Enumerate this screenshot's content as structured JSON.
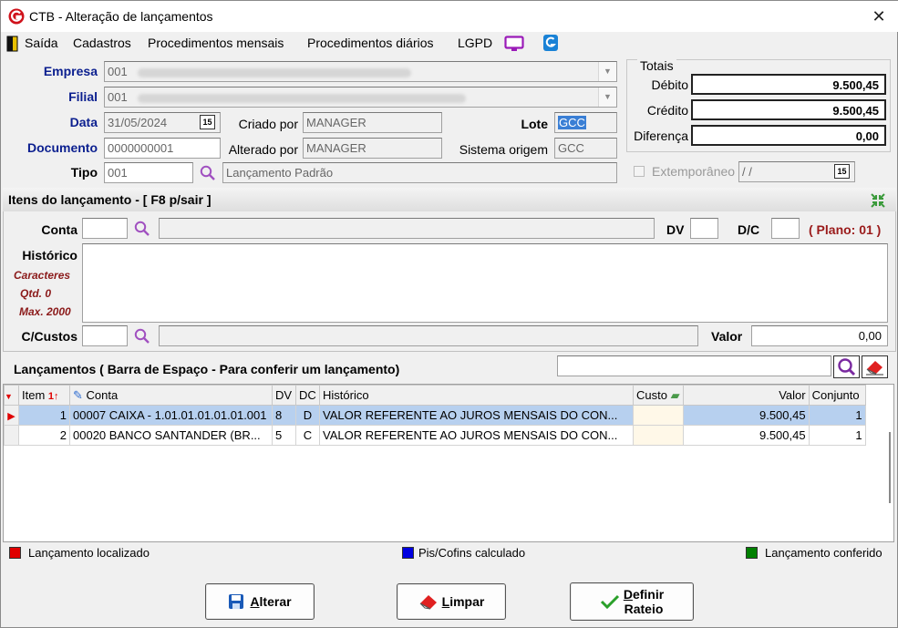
{
  "window": {
    "title": "CTB - Alteração de lançamentos",
    "close": "✕"
  },
  "menu": {
    "items": [
      "Saída",
      "Cadastros",
      "Procedimentos mensais",
      "Procedimentos diários",
      "LGPD"
    ]
  },
  "header": {
    "empresa_label": "Empresa",
    "empresa_value": "001",
    "filial_label": "Filial",
    "filial_value": "001",
    "data_label": "Data",
    "data_value": "31/05/2024",
    "documento_label": "Documento",
    "documento_value": "0000000001",
    "tipo_label": "Tipo",
    "tipo_value": "001",
    "tipo_desc": "Lançamento Padrão",
    "criado_label": "Criado por",
    "criado_value": "MANAGER",
    "alterado_label": "Alterado por",
    "alterado_value": "MANAGER",
    "lote_label": "Lote",
    "lote_value": "GCC",
    "sistema_label": "Sistema origem",
    "sistema_value": "GCC",
    "calendar_text": "15"
  },
  "totais": {
    "legend": "Totais",
    "debito_label": "Débito",
    "debito_value": "9.500,45",
    "credito_label": "Crédito",
    "credito_value": "9.500,45",
    "diferenca_label": "Diferença",
    "diferenca_value": "0,00",
    "extemporaneo_label": "Extemporâneo",
    "extemporaneo_value": "/ /"
  },
  "itens": {
    "title": "Itens do lançamento - [ F8 p/sair ]",
    "conta_label": "Conta",
    "dv_label": "DV",
    "dc_label": "D/C",
    "plano": "( Plano: 01 )",
    "historico_label": "Histórico",
    "caracteres_label": "Caracteres",
    "qtd_label": "Qtd. 0",
    "max_label": "Max. 2000",
    "ccustos_label": "C/Custos",
    "valor_label": "Valor",
    "valor_value": "0,00"
  },
  "lancamentos": {
    "title": "Lançamentos ( Barra de Espaço - Para conferir um lançamento)",
    "columns": [
      "Item",
      "Conta",
      "DV",
      "DC",
      "Histórico",
      "Custo",
      "Valor",
      "Conjunto"
    ],
    "rows": [
      {
        "item": "1",
        "conta": "00007 CAIXA - 1.01.01.01.01.01.001",
        "dv": "8",
        "dc": "D",
        "historico": "VALOR REFERENTE AO JUROS MENSAIS DO CON...",
        "custo": "",
        "valor": "9.500,45",
        "conjunto": "1"
      },
      {
        "item": "2",
        "conta": "00020 BANCO SANTANDER (BR...",
        "dv": "5",
        "dc": "C",
        "historico": "VALOR REFERENTE AO JUROS MENSAIS DO CON...",
        "custo": "",
        "valor": "9.500,45",
        "conjunto": "1"
      }
    ]
  },
  "legend": {
    "localizado": "Lançamento localizado",
    "piscofins": "Pis/Cofins calculado",
    "conferido": "Lançamento conferido",
    "colors": {
      "localizado": "#e00000",
      "piscofins": "#0000e0",
      "conferido": "#008000"
    }
  },
  "buttons": {
    "alterar_first": "A",
    "alterar_rest": "lterar",
    "limpar_first": "L",
    "limpar_rest": "impar",
    "definir_first": "D",
    "definir_rest": "efinir",
    "rateio": "Rateio"
  }
}
